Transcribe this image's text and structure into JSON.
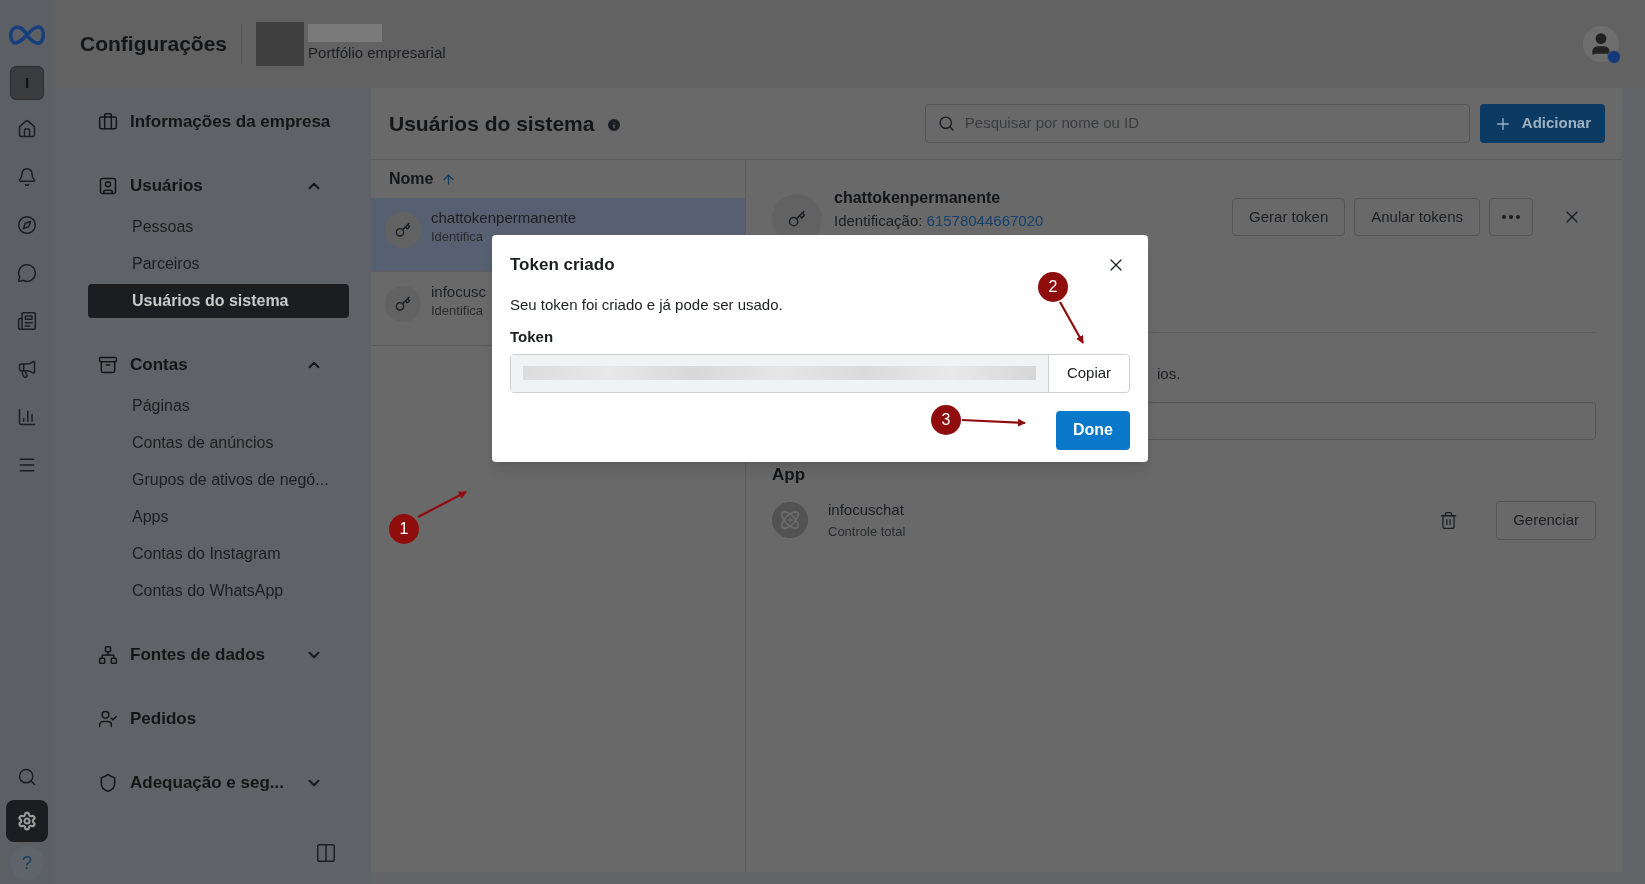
{
  "header": {
    "title": "Configurações",
    "portfolio_subtitle": "Portfólio empresarial"
  },
  "rail": {
    "account_initial": "I",
    "help_label": "?",
    "items": [
      {
        "kind": "home",
        "selected": false
      },
      {
        "kind": "bell",
        "selected": false
      },
      {
        "kind": "compass",
        "selected": false
      },
      {
        "kind": "chat",
        "selected": false
      },
      {
        "kind": "pages",
        "selected": false
      },
      {
        "kind": "megaphone",
        "selected": false
      },
      {
        "kind": "chart",
        "selected": false
      },
      {
        "kind": "menu",
        "selected": false
      },
      {
        "kind": "search",
        "selected": false
      },
      {
        "kind": "settings",
        "selected": true
      }
    ]
  },
  "sidebar": {
    "sections": [
      {
        "label": "Informações da empresa"
      },
      {
        "label": "Usuários",
        "expanded": true,
        "children": [
          {
            "label": "Pessoas",
            "selected": false
          },
          {
            "label": "Parceiros",
            "selected": false
          },
          {
            "label": "Usuários do sistema",
            "selected": true
          }
        ]
      },
      {
        "label": "Contas",
        "expanded": true,
        "children": [
          {
            "label": "Páginas",
            "selected": false
          },
          {
            "label": "Contas de anúncios",
            "selected": false
          },
          {
            "label": "Grupos de ativos de negó...",
            "selected": false
          },
          {
            "label": "Apps",
            "selected": false
          },
          {
            "label": "Contas do Instagram",
            "selected": false
          },
          {
            "label": "Contas do WhatsApp",
            "selected": false
          }
        ]
      },
      {
        "label": "Fontes de dados",
        "expanded": false
      },
      {
        "label": "Pedidos"
      },
      {
        "label": "Adequação e seg...",
        "expanded": false
      }
    ]
  },
  "main": {
    "title": "Usuários do sistema",
    "search": {
      "placeholder": "Pesquisar por nome ou ID"
    },
    "add_button": "Adicionar",
    "list": {
      "column": "Nome",
      "rows": [
        {
          "name": "chattokenpermanente",
          "subtitle": "Identifica",
          "selected": true
        },
        {
          "name": "infocusc",
          "subtitle": "Identifica",
          "selected": false
        }
      ]
    },
    "detail": {
      "name": "chattokenpermanente",
      "id_label": "Identificação:",
      "id_value": "61578044667020",
      "buttons": [
        "Gerar token",
        "Anular tokens"
      ],
      "partial_text": "ios.",
      "app_section": {
        "heading": "App",
        "name": "infocuschat",
        "access": "Controle total",
        "manage_button": "Gerenciar"
      }
    }
  },
  "dialog": {
    "title": "Token criado",
    "message": "Seu token foi criado e já pode ser usado.",
    "token_label": "Token",
    "copy_button": "Copiar",
    "done_button": "Done"
  },
  "annotations": [
    {
      "number": "1"
    },
    {
      "number": "2"
    },
    {
      "number": "3"
    }
  ]
}
